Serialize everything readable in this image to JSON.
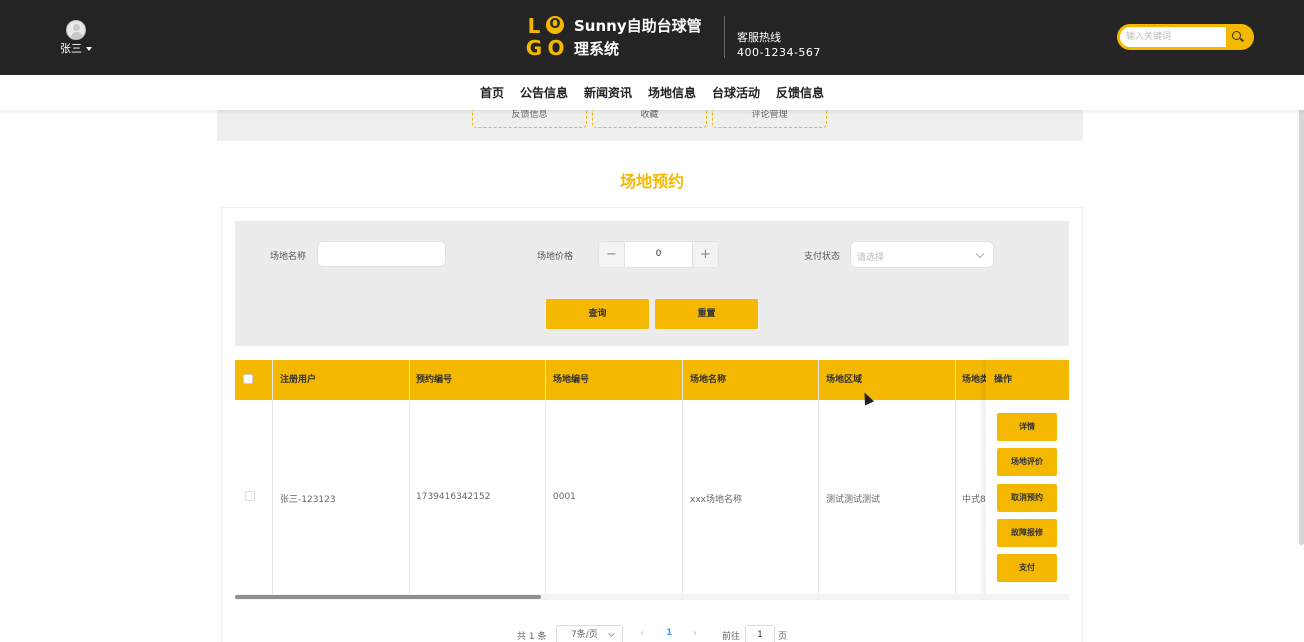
{
  "header": {
    "user_name": "张三",
    "logo_letters": [
      "L",
      "O",
      "G",
      "O"
    ],
    "site_title": "Sunny自助台球管理系统",
    "hotline_label": "客服热线",
    "hotline_number": "400-1234-567",
    "search_placeholder": "输入关键词"
  },
  "nav": {
    "items": [
      {
        "label": "首页"
      },
      {
        "label": "公告信息"
      },
      {
        "label": "新闻资讯"
      },
      {
        "label": "场地信息"
      },
      {
        "label": "台球活动"
      },
      {
        "label": "反馈信息"
      }
    ]
  },
  "sub_menu": [
    "反馈信息",
    "收藏",
    "评论管理"
  ],
  "page_title": "场地预约",
  "filters": {
    "venue_name_label": "场地名称",
    "venue_name_value": "",
    "venue_price_label": "场地价格",
    "venue_price_value": "0",
    "pay_status_label": "支付状态",
    "pay_status_placeholder": "请选择",
    "query_label": "查询",
    "reset_label": "重置"
  },
  "table": {
    "columns": [
      "注册用户",
      "预约编号",
      "场地编号",
      "场地名称",
      "场地区域",
      "场地类",
      "操作"
    ],
    "rows": [
      {
        "user": "张三-123123",
        "booking_no": "1739416342152",
        "venue_no": "0001",
        "venue_name": "xxx场地名称",
        "venue_area": "测试测试测试",
        "venue_type": "中式8"
      }
    ],
    "actions": [
      "详情",
      "场地评价",
      "取消预约",
      "故障报修",
      "支付"
    ]
  },
  "pagination": {
    "total": "共 1 条",
    "page_size": "7条/页",
    "current_page": "1",
    "goto_label": "前往",
    "goto_value": "1",
    "page_suffix": "页"
  },
  "colors": {
    "accent": "#f5b800",
    "header_bg": "#242424"
  }
}
